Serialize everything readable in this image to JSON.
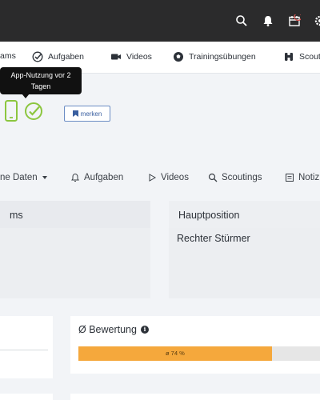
{
  "colors": {
    "topbar": "#2b2b2c",
    "accent_green": "#8cc63f",
    "progress": "#f5a83c",
    "notification": "#d9534f"
  },
  "topbar": {
    "icons": [
      "search-icon",
      "bell-icon",
      "calendar-icon",
      "gear-icon"
    ]
  },
  "nav": {
    "items": [
      {
        "label": "ams",
        "icon": "team-icon"
      },
      {
        "label": "Aufgaben",
        "icon": "check-circle-icon"
      },
      {
        "label": "Videos",
        "icon": "video-camera-icon"
      },
      {
        "label": "Trainingsübungen",
        "icon": "soccer-ball-icon"
      },
      {
        "label": "Scout",
        "icon": "binoculars-icon"
      }
    ]
  },
  "tooltip": {
    "line1": "App-Nutzung vor 2",
    "line2": "Tagen"
  },
  "profile": {
    "merken_label": "merken"
  },
  "tabs": [
    {
      "label": "ne Daten",
      "icon": ""
    },
    {
      "label": "Aufgaben",
      "icon": "bell-icon"
    },
    {
      "label": "Videos",
      "icon": "play-icon"
    },
    {
      "label": "Scoutings",
      "icon": "search-icon"
    },
    {
      "label": "Notiz",
      "icon": "note-icon"
    }
  ],
  "cards": {
    "left_title": "ms",
    "position_title": "Hauptposition",
    "position_value": "Rechter Stürmer",
    "rating_title": "Ø Bewertung",
    "rating_info": "i",
    "rating_percent_label": "ø 74 %",
    "rating_fraction": 0.78
  }
}
